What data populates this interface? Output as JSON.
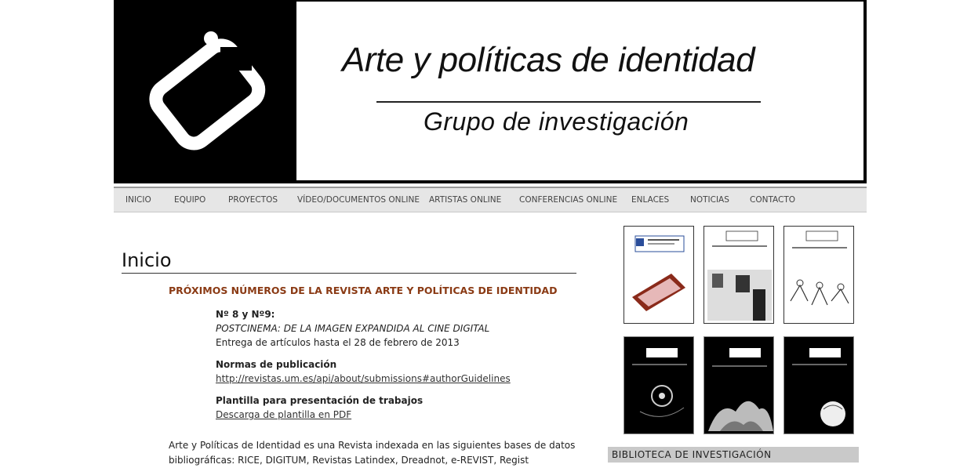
{
  "header": {
    "title": "Arte y políticas de identidad",
    "subtitle": "Grupo de investigación"
  },
  "nav": {
    "items": [
      "INICIO",
      "EQUIPO",
      "PROYECTOS",
      "VÍDEO/DOCUMENTOS ONLINE",
      "ARTISTAS ONLINE",
      "CONFERENCIAS ONLINE",
      "ENLACES",
      "NOTICIAS",
      "CONTACTO"
    ]
  },
  "main": {
    "page_title": "Inicio",
    "section_heading": "PRÓXIMOS NÚMEROS DE LA REVISTA  ARTE Y POLÍTICAS DE IDENTIDAD",
    "issue": {
      "label": "Nº 8 y Nº9:",
      "theme": "POSTCINEMA: DE LA IMAGEN EXPANDIDA AL CINE DIGITAL",
      "deadline": "Entrega de artículos hasta el 28 de febrero de 2013"
    },
    "norms": {
      "label": "Normas de publicación",
      "link": "http://revistas.um.es/api/about/submissions#authorGuidelines"
    },
    "template": {
      "label": "Plantilla para presentación de trabajos",
      "link": "Descarga de plantilla en PDF"
    },
    "intro": "Arte y Políticas de Identidad es una Revista indexada en las siguientes bases de datos bibliográficas: RICE, DIGITUM, Revistas Latindex, Dreadnot, e-REVIST, Regist"
  },
  "sidebar": {
    "heading": "BIBLIOTECA DE INVESTIGACIÓN"
  },
  "colors": {
    "accent": "#8a3a14",
    "nav_bg": "#e6e6e6",
    "header_bg": "#000000"
  }
}
